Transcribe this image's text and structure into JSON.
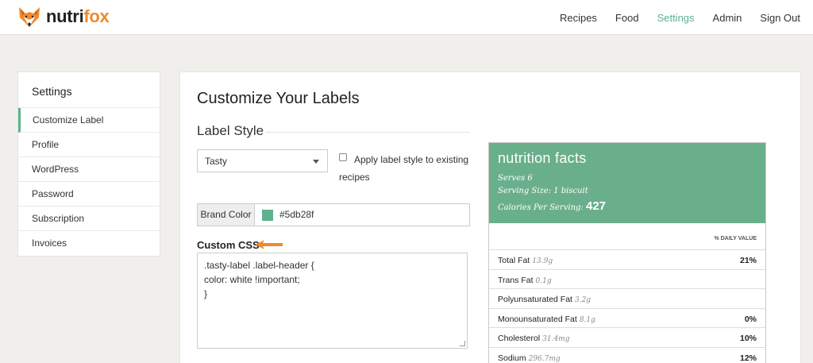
{
  "brand": {
    "logo_part1": "nutri",
    "logo_part2": "fox"
  },
  "nav": [
    {
      "label": "Recipes",
      "active": false
    },
    {
      "label": "Food",
      "active": false
    },
    {
      "label": "Settings",
      "active": true
    },
    {
      "label": "Admin",
      "active": false
    },
    {
      "label": "Sign Out",
      "active": false
    }
  ],
  "sidebar": {
    "title": "Settings",
    "items": [
      {
        "label": "Customize Label",
        "active": true
      },
      {
        "label": "Profile"
      },
      {
        "label": "WordPress"
      },
      {
        "label": "Password"
      },
      {
        "label": "Subscription"
      },
      {
        "label": "Invoices"
      }
    ]
  },
  "main": {
    "title": "Customize Your Labels",
    "section_title": "Label Style",
    "style_select": {
      "value": "Tasty"
    },
    "apply_checkbox": {
      "label": "Apply label style to existing recipes",
      "checked": false
    },
    "brand_color": {
      "label": "Brand Color",
      "value": "#5db28f"
    },
    "custom_css": {
      "label": "Custom CSS",
      "lines": [
        ".tasty-label .label-header {",
        "color: white !important;",
        "}"
      ]
    }
  },
  "nutrition": {
    "header_title": "nutrition facts",
    "serves": "Serves 6",
    "serving_size": "Serving Size: 1 biscuit",
    "calories_label": "Calories Per Serving:",
    "calories_value": "427",
    "daily_value_header": "% DAILY VALUE",
    "rows": [
      {
        "name": "Total Fat",
        "amount": "13.9g",
        "pct": "21%"
      },
      {
        "name": "Trans Fat",
        "amount": "0.1g",
        "pct": ""
      },
      {
        "name": "Polyunsaturated Fat",
        "amount": "3.2g",
        "pct": ""
      },
      {
        "name": "Monounsaturated Fat",
        "amount": "8.1g",
        "pct": "0%"
      },
      {
        "name": "Cholesterol",
        "amount": "31.4mg",
        "pct": "10%"
      },
      {
        "name": "Sodium",
        "amount": "296.7mg",
        "pct": "12%"
      }
    ]
  },
  "colors": {
    "accent": "#5db28f",
    "label_header": "#6aaf8c",
    "logo_orange": "#f08a2b"
  },
  "icons": {
    "logo": "fox-logo-icon",
    "arrow": "arrow-left-icon",
    "caret": "chevron-down-icon"
  }
}
